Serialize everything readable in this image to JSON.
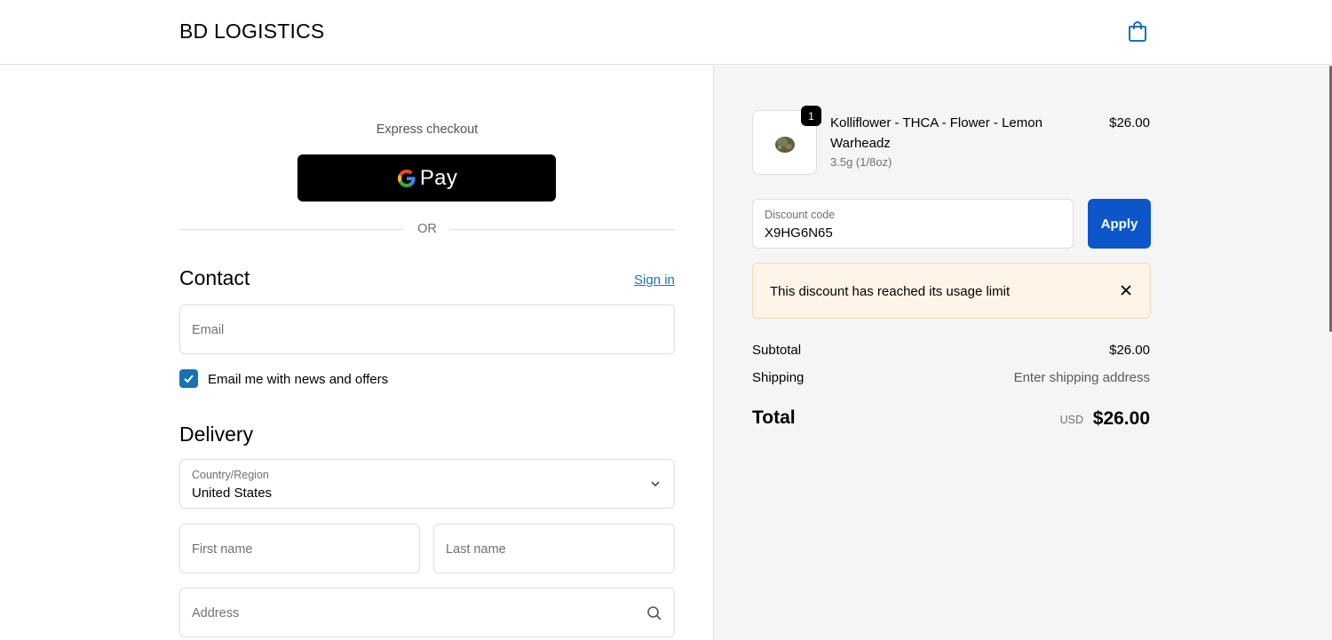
{
  "header": {
    "brand": "BD LOGISTICS",
    "cart_icon": "shopping-bag-icon",
    "accent": "#1773b0"
  },
  "express": {
    "label": "Express checkout",
    "gpay_label": "Pay",
    "or_label": "OR"
  },
  "contact": {
    "title": "Contact",
    "sign_in": "Sign in",
    "email_placeholder": "Email",
    "newsletter_label": "Email me with news and offers",
    "newsletter_checked": true
  },
  "delivery": {
    "title": "Delivery",
    "country_label": "Country/Region",
    "country_value": "United States",
    "first_name_placeholder": "First name",
    "last_name_placeholder": "Last name",
    "address_placeholder": "Address"
  },
  "summary": {
    "item": {
      "quantity": "1",
      "name": "Kolliflower - THCA - Flower - Lemon Warheadz",
      "variant": "3.5g (1/8oz)",
      "price": "$26.00"
    },
    "discount": {
      "label": "Discount code",
      "value": "X9HG6N65",
      "apply_label": "Apply",
      "apply_color": "#0d56c9",
      "error": "This discount has reached its usage limit"
    },
    "subtotal_label": "Subtotal",
    "subtotal_value": "$26.00",
    "shipping_label": "Shipping",
    "shipping_value": "Enter shipping address",
    "total_label": "Total",
    "total_currency": "USD",
    "total_value": "$26.00"
  }
}
